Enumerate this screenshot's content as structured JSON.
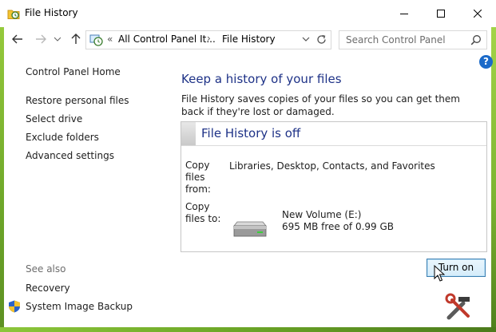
{
  "window": {
    "title": "File History",
    "caption_buttons": [
      "minimize",
      "maximize",
      "close"
    ]
  },
  "navigation": {
    "breadcrumb_prefix": "«",
    "breadcrumb": [
      "All Control Panel It...",
      "File History"
    ],
    "breadcrumb_separator": "›",
    "search_placeholder": "Search Control Panel"
  },
  "help_label": "?",
  "sidebar": {
    "home": "Control Panel Home",
    "links": [
      "Restore personal files",
      "Select drive",
      "Exclude folders",
      "Advanced settings"
    ],
    "see_also_title": "See also",
    "see_also": [
      "Recovery",
      "System Image Backup"
    ]
  },
  "main": {
    "heading": "Keep a history of your files",
    "description": "File History saves copies of your files so you can get them back if they're lost or damaged.",
    "status_title": "File History is off",
    "copy_from_label_lines": [
      "Copy",
      "files",
      "from:"
    ],
    "copy_from_value": "Libraries, Desktop, Contacts, and Favorites",
    "copy_to_label_lines": [
      "Copy",
      "files to:"
    ],
    "drive_name": "New Volume (E:)",
    "drive_free": "695 MB free of 0.99 GB",
    "turn_on_button": "Turn on"
  },
  "colors": {
    "heading": "#1e3287",
    "accent_green": "#7cb431",
    "help_blue": "#1b6ac9",
    "button_border": "#3c7fb1"
  }
}
